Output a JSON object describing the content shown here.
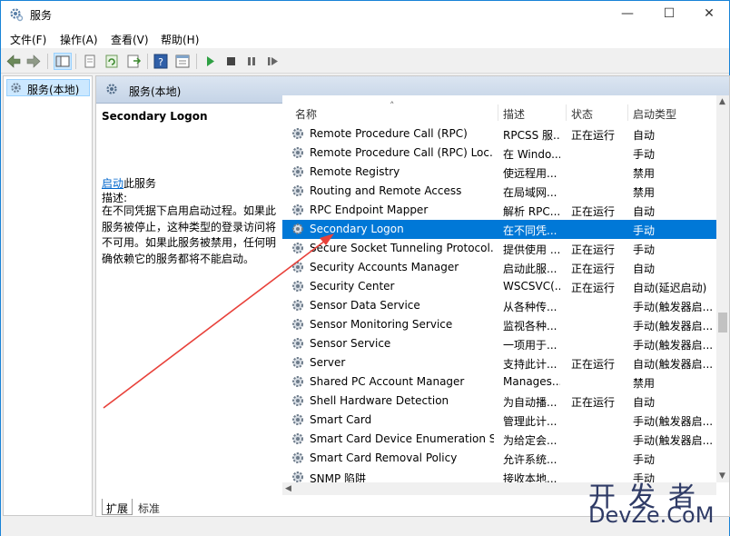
{
  "window": {
    "title": "服务",
    "minimize_icon": "minimize-icon",
    "maximize_icon": "maximize-icon",
    "close_icon": "close-icon"
  },
  "menu": [
    "文件(F)",
    "操作(A)",
    "查看(V)",
    "帮助(H)"
  ],
  "toolbar": {
    "icons": [
      "back-icon",
      "forward-icon",
      "show-tree-icon",
      "properties-icon",
      "refresh-icon",
      "export-icon",
      "help-icon",
      "view-icon",
      "start-icon",
      "stop-icon",
      "pause-icon",
      "restart-icon"
    ]
  },
  "tree": {
    "item": "服务(本地)"
  },
  "pane": {
    "header": "服务(本地)",
    "detail": {
      "service_name": "Secondary Logon",
      "start_link": "启动",
      "start_suffix": "此服务",
      "desc_label": "描述:",
      "desc_text": "在不同凭据下启用启动过程。如果此服务被停止，这种类型的登录访问将不可用。如果此服务被禁用，任何明确依赖它的服务都将不能启动。"
    },
    "columns": {
      "name": "名称",
      "desc": "描述",
      "status": "状态",
      "type": "启动类型"
    },
    "rows": [
      {
        "name": "Remote Procedure Call (RPC)",
        "desc": "RPCSS 服...",
        "status": "正在运行",
        "type": "自动"
      },
      {
        "name": "Remote Procedure Call (RPC) Loc...",
        "desc": "在 Windo...",
        "status": "",
        "type": "手动"
      },
      {
        "name": "Remote Registry",
        "desc": "使远程用...",
        "status": "",
        "type": "禁用"
      },
      {
        "name": "Routing and Remote Access",
        "desc": "在局域网...",
        "status": "",
        "type": "禁用"
      },
      {
        "name": "RPC Endpoint Mapper",
        "desc": "解析 RPC...",
        "status": "正在运行",
        "type": "自动"
      },
      {
        "name": "Secondary Logon",
        "desc": "在不同凭...",
        "status": "",
        "type": "手动",
        "selected": true
      },
      {
        "name": "Secure Socket Tunneling Protocol...",
        "desc": "提供使用 ...",
        "status": "正在运行",
        "type": "手动"
      },
      {
        "name": "Security Accounts Manager",
        "desc": "启动此服...",
        "status": "正在运行",
        "type": "自动"
      },
      {
        "name": "Security Center",
        "desc": "WSCSVC(...",
        "status": "正在运行",
        "type": "自动(延迟启动)"
      },
      {
        "name": "Sensor Data Service",
        "desc": "从各种传...",
        "status": "",
        "type": "手动(触发器启..."
      },
      {
        "name": "Sensor Monitoring Service",
        "desc": "监视各种...",
        "status": "",
        "type": "手动(触发器启..."
      },
      {
        "name": "Sensor Service",
        "desc": "一项用于...",
        "status": "",
        "type": "手动(触发器启..."
      },
      {
        "name": "Server",
        "desc": "支持此计...",
        "status": "正在运行",
        "type": "自动(触发器启..."
      },
      {
        "name": "Shared PC Account Manager",
        "desc": "Manages...",
        "status": "",
        "type": "禁用"
      },
      {
        "name": "Shell Hardware Detection",
        "desc": "为自动播...",
        "status": "正在运行",
        "type": "自动"
      },
      {
        "name": "Smart Card",
        "desc": "管理此计...",
        "status": "",
        "type": "手动(触发器启..."
      },
      {
        "name": "Smart Card Device Enumeration S...",
        "desc": "为给定会...",
        "status": "",
        "type": "手动(触发器启..."
      },
      {
        "name": "Smart Card Removal Policy",
        "desc": "允许系统...",
        "status": "",
        "type": "手动"
      },
      {
        "name": "SNMP 陷阱",
        "desc": "接收本地...",
        "status": "",
        "type": "手动"
      }
    ],
    "tabs": [
      "扩展",
      "标准"
    ]
  },
  "watermark": {
    "line1": "开发者",
    "line2": "DevZe.CoM"
  },
  "colors": {
    "selection": "#0078d7",
    "link": "#0066cc",
    "annotation_arrow": "#e8413a"
  }
}
